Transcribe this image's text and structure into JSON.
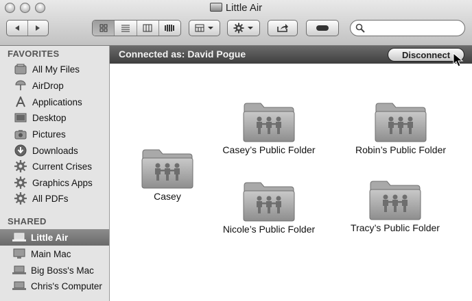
{
  "window": {
    "title": "Little Air"
  },
  "search": {
    "placeholder": "",
    "value": ""
  },
  "sidebar": {
    "favorites_header": "FAVORITES",
    "favorites": [
      {
        "label": "All My Files",
        "icon": "all-files-icon"
      },
      {
        "label": "AirDrop",
        "icon": "airdrop-icon"
      },
      {
        "label": "Applications",
        "icon": "applications-icon"
      },
      {
        "label": "Desktop",
        "icon": "desktop-icon"
      },
      {
        "label": "Pictures",
        "icon": "camera-icon"
      },
      {
        "label": "Downloads",
        "icon": "downloads-icon"
      },
      {
        "label": "Current Crises",
        "icon": "gear-icon"
      },
      {
        "label": "Graphics Apps",
        "icon": "gear-icon"
      },
      {
        "label": "All PDFs",
        "icon": "gear-icon"
      }
    ],
    "shared_header": "SHARED",
    "shared": [
      {
        "label": "Little Air",
        "icon": "laptop-icon",
        "selected": true
      },
      {
        "label": "Main Mac",
        "icon": "computer-icon"
      },
      {
        "label": "Big Boss's Mac",
        "icon": "laptop-icon"
      },
      {
        "label": "Chris's Computer",
        "icon": "laptop-icon"
      }
    ]
  },
  "connection": {
    "status": "Connected as: David Pogue",
    "disconnect_label": "Disconnect"
  },
  "folders": [
    {
      "name": "Casey"
    },
    {
      "name": "Casey’s Public Folder"
    },
    {
      "name": "Robin’s Public Folder"
    },
    {
      "name": "Nicole’s Public Folder"
    },
    {
      "name": "Tracy’s Public Folder"
    }
  ]
}
